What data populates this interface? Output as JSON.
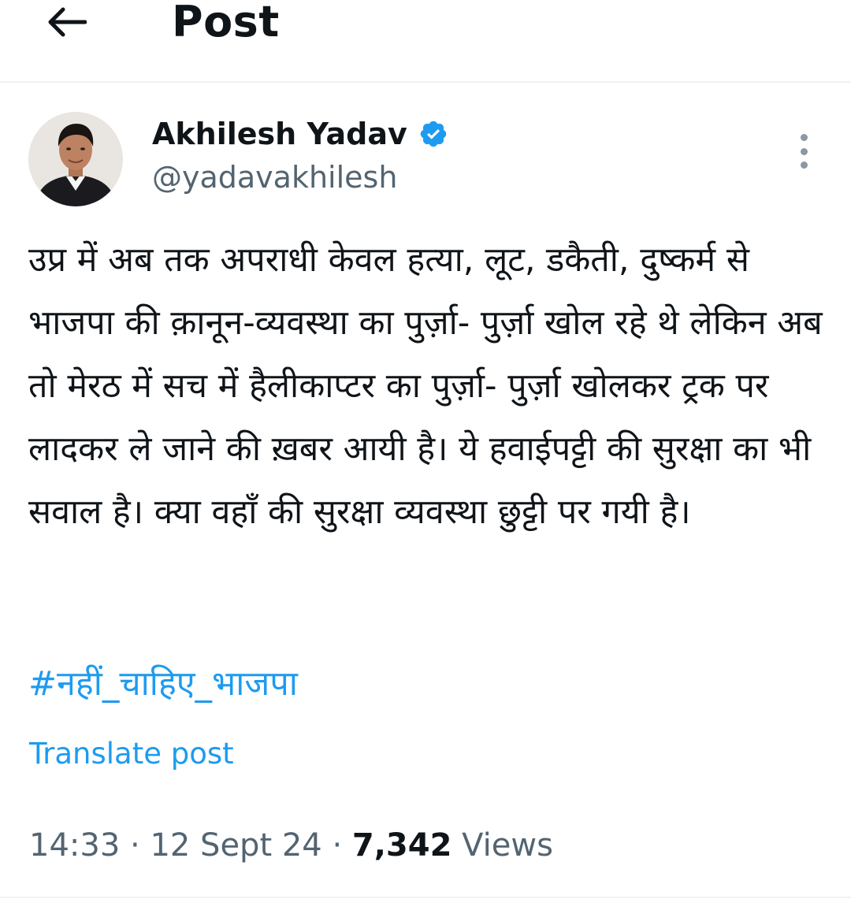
{
  "header": {
    "title": "Post",
    "back_icon": "arrow-left-icon"
  },
  "author": {
    "name": "Akhilesh Yadav",
    "handle": "@yadavakhilesh",
    "verified_icon": "verified-badge-icon",
    "more_icon": "more-options-icon"
  },
  "post": {
    "text": "उप्र में अब तक अपराधी केवल हत्या, लूट, डकैती, दुष्कर्म से भाजपा की क़ानून-व्यवस्था का पुर्ज़ा- पुर्ज़ा खोल रहे थे लेकिन अब तो मेरठ में सच में हैलीकाप्टर का पुर्ज़ा- पुर्ज़ा खोलकर ट्रक पर लादकर ले जाने की ख़बर आयी है। ये हवाईपट्टी की सुरक्षा का भी सवाल है। क्या वहाँ की सुरक्षा व्यवस्था छुट्टी पर गयी है।",
    "hashtag": "#नहीं_चाहिए_भाजपा",
    "translate_label": "Translate post"
  },
  "meta": {
    "time": "14:33",
    "separator": " · ",
    "date": "12 Sept 24",
    "views_count": "7,342",
    "views_label": " Views"
  },
  "colors": {
    "accent": "#1d9bf0",
    "text_primary": "#0f1419",
    "text_secondary": "#536471",
    "divider": "#eff3f4"
  }
}
